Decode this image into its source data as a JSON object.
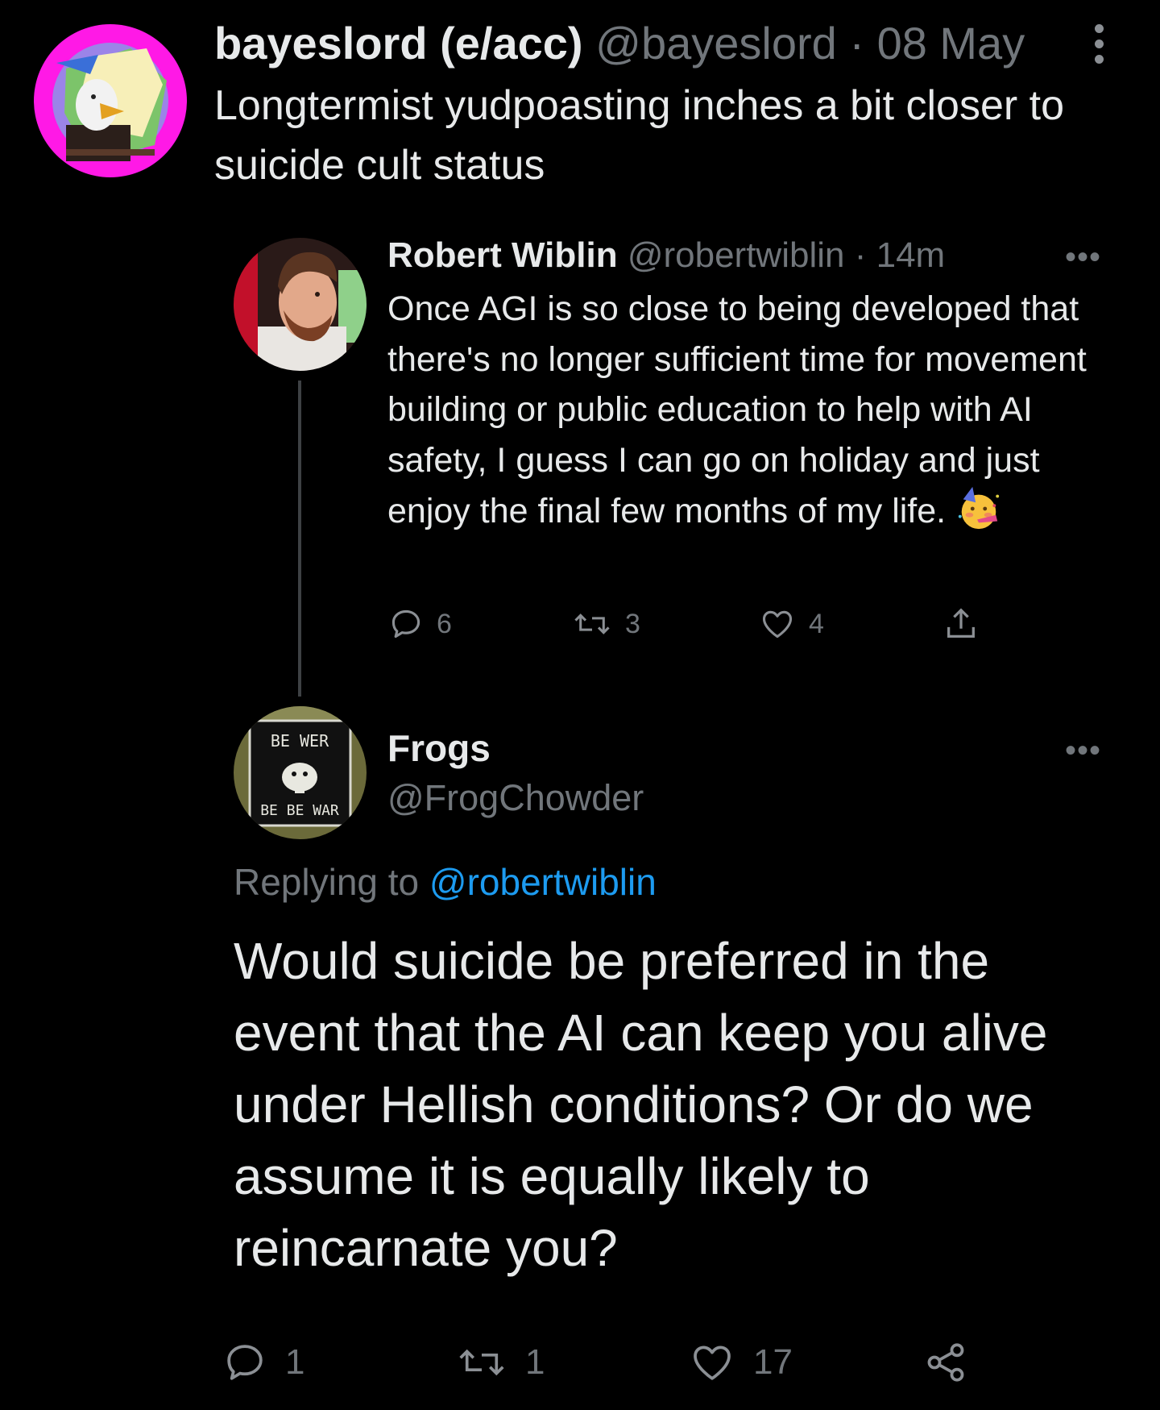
{
  "top_tweet": {
    "display_name": "bayeslord (e/acc)",
    "handle": "@bayeslord",
    "separator": "·",
    "date": "08 May",
    "text": "Longtermist yudpoasting inches a bit closer to suicide cult status",
    "menu_icon": "vertical-ellipsis-icon"
  },
  "parent_tweet": {
    "display_name": "Robert Wiblin",
    "handle": "@robertwiblin",
    "separator": "·",
    "time": "14m",
    "more_icon": "horizontal-ellipsis-icon",
    "text": "Once AGI is so close to being developed that there's no longer sufficient time for movement building or public education to help with AI safety, I guess I can go on holiday and just enjoy the final few months of my life.",
    "emoji": "partying-face-emoji",
    "actions": {
      "reply_count": "6",
      "retweet_count": "3",
      "like_count": "4"
    }
  },
  "main_tweet": {
    "display_name": "Frogs",
    "handle": "@FrogChowder",
    "more_icon": "horizontal-ellipsis-icon",
    "replying_prefix": "Replying to",
    "replying_to": "@robertwiblin",
    "text": "Would suicide be preferred in the event that the AI can keep you alive under Hellish conditions? Or do we assume it is equally likely to reincarnate you?",
    "avatar_sign_top": "BE WER",
    "avatar_sign_bottom": "BE BE WAR",
    "actions": {
      "reply_count": "1",
      "retweet_count": "1",
      "like_count": "17"
    }
  },
  "colors": {
    "background": "#000000",
    "primary_text": "#e7e9ea",
    "secondary_text": "#71767b",
    "link": "#1d9bf0",
    "thread_line": "#3e4144"
  }
}
